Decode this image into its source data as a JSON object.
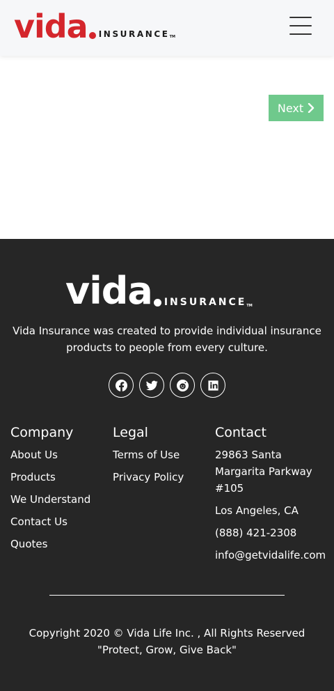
{
  "header": {
    "logo": {
      "main": "vida",
      "sub": "INSURANCE",
      "tm": "TM"
    }
  },
  "main": {
    "next_label": "Next"
  },
  "footer": {
    "logo": {
      "main": "vida",
      "sub": "INSURANCE",
      "tm": "TM"
    },
    "description": "Vida Insurance was created to provide individual insurance products to people from every culture.",
    "social": [
      "facebook-icon",
      "twitter-icon",
      "reddit-icon",
      "linkedin-icon"
    ],
    "company": {
      "title": "Company",
      "links": [
        "About Us",
        "Products",
        "We Understand",
        "Contact Us",
        "Quotes"
      ]
    },
    "legal": {
      "title": "Legal",
      "links": [
        "Terms of Use",
        "Privacy Policy"
      ]
    },
    "contact": {
      "title": "Contact",
      "address": "29863 Santa Margarita Parkway #105",
      "city": "Los Angeles, CA",
      "phone": "(888) 421-2308",
      "email": "info@getvidalife.com"
    },
    "copyright": "Copyright 2020 © Vida Life Inc. , All Rights Reserved",
    "tagline": "\"Protect, Grow, Give Back\""
  }
}
